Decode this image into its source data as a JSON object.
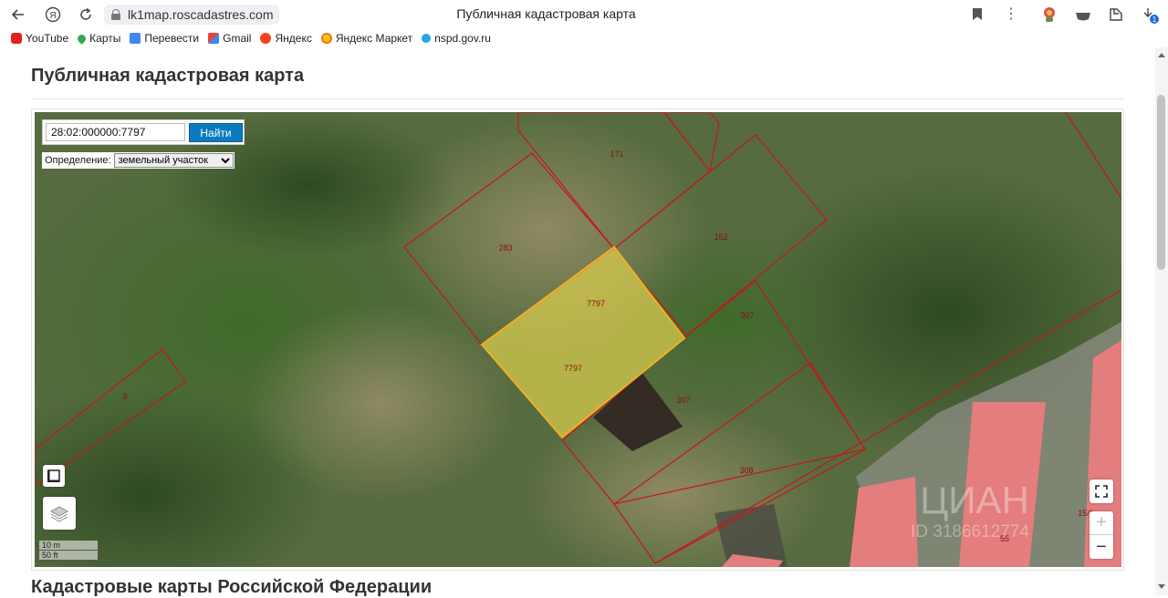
{
  "browser": {
    "url": "lk1map.roscadastres.com",
    "tab_title": "Публичная кадастровая карта",
    "bookmarks": [
      {
        "label": "YouTube",
        "icon": "youtube-icon"
      },
      {
        "label": "Карты",
        "icon": "maps-pin-icon"
      },
      {
        "label": "Перевести",
        "icon": "translate-icon"
      },
      {
        "label": "Gmail",
        "icon": "gmail-icon"
      },
      {
        "label": "Яндекс",
        "icon": "yandex-icon"
      },
      {
        "label": "Яндекс Маркет",
        "icon": "yandex-market-icon"
      },
      {
        "label": "nspd.gov.ru",
        "icon": "site-icon"
      }
    ],
    "download_badge": "1"
  },
  "page": {
    "title": "Публичная кадастровая карта",
    "section_title": "Кадастровые карты Российской Федерации"
  },
  "map": {
    "search_value": "28:02:000000:7797",
    "search_button": "Найти",
    "definition_label": "Определение:",
    "definition_value": "земельный участок",
    "scale_metric": "10 m",
    "scale_imperial": "50 ft",
    "zoom_in": "+",
    "zoom_out": "−",
    "parcel_labels": {
      "p171": "171",
      "p152": "152",
      "p283": "283",
      "p7797a": "7797",
      "p7797b": "7797",
      "p307a": "307",
      "p307b": "307",
      "p308": "308",
      "p3": "3",
      "p55": "55",
      "p15": "15/1"
    },
    "watermark": "ЦИАН",
    "watermark_id": "ID 3186612774",
    "colors": {
      "parcel_border": "#c41818",
      "selected_fill": "#e0d050",
      "selected_border": "#f0b020",
      "building_fill": "#e47d7d",
      "button_blue": "#0a7bbf"
    }
  }
}
